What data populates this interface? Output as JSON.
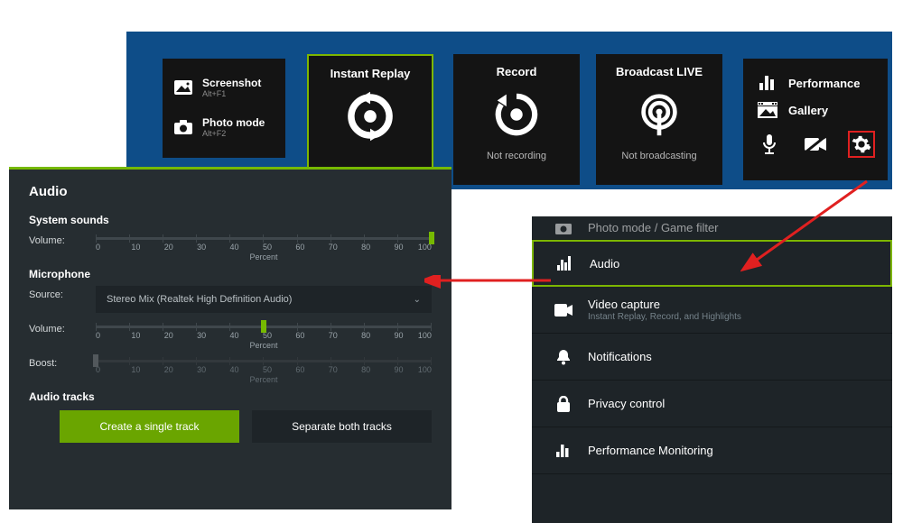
{
  "overlay": {
    "screenshot": {
      "title": "Screenshot",
      "shortcut": "Alt+F1"
    },
    "photomode": {
      "title": "Photo mode",
      "shortcut": "Alt+F2"
    },
    "replay": {
      "title": "Instant Replay"
    },
    "record": {
      "title": "Record",
      "status": "Not recording"
    },
    "broadcast": {
      "title": "Broadcast LIVE",
      "status": "Not broadcasting"
    },
    "side": {
      "performance": "Performance",
      "gallery": "Gallery"
    }
  },
  "sidebar": {
    "partial_top": "Photo mode / Game filter",
    "audio": "Audio",
    "videocap": {
      "label": "Video capture",
      "sub": "Instant Replay, Record, and Highlights"
    },
    "notifications": "Notifications",
    "privacy": "Privacy control",
    "perfmon": "Performance Monitoring"
  },
  "audio_panel": {
    "title": "Audio",
    "system_sounds": "System sounds",
    "microphone": "Microphone",
    "audio_tracks": "Audio tracks",
    "labels": {
      "volume": "Volume:",
      "source": "Source:",
      "boost": "Boost:",
      "percent": "Percent"
    },
    "ticks": [
      "0",
      "10",
      "20",
      "30",
      "40",
      "50",
      "60",
      "70",
      "80",
      "90",
      "100"
    ],
    "values": {
      "system_volume_pct": 100,
      "mic_volume_pct": 50,
      "boost_pct": 0
    },
    "mic_source": "Stereo Mix (Realtek High Definition Audio)",
    "btn_single": "Create a single track",
    "btn_separate": "Separate both tracks"
  },
  "icons": {
    "screenshot": "screenshot-icon",
    "camera": "camera-icon",
    "replay": "instant-replay-icon",
    "record": "record-icon",
    "broadcast": "broadcast-icon",
    "bars": "bars-icon",
    "gallery": "gallery-icon",
    "mic": "mic-icon",
    "cam_off": "camera-off-icon",
    "gear": "gear-icon",
    "audio_eq": "equalizer-icon",
    "videocam": "videocam-icon",
    "bell": "bell-icon",
    "lock": "lock-icon"
  },
  "colors": {
    "accent": "#76b900",
    "highlight_red": "#e02020"
  }
}
